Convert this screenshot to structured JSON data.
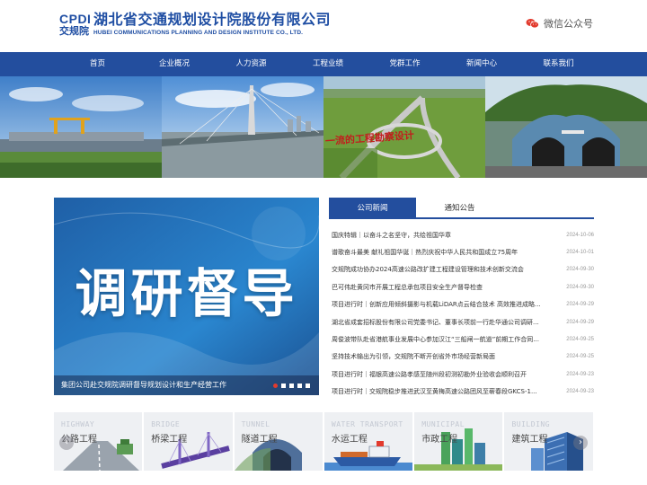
{
  "header": {
    "logo_en": "CPDI",
    "logo_cn": "交规院",
    "org_name_cn": "湖北省交通规划设计院股份有限公司",
    "org_name_en": "HUBEI COMMUNICATIONS PLANNING AND DESIGN INSTITUTE CO., LTD.",
    "wechat_label": "微信公众号"
  },
  "nav": {
    "items": [
      "首页",
      "企业概况",
      "人力资源",
      "工程业绩",
      "党群工作",
      "新闻中心",
      "联系我们"
    ]
  },
  "banner": {
    "slogan": "一流的工程勘察设计"
  },
  "feature": {
    "headline": "调研督导",
    "caption": "集团公司赴交规院调研督导规划设计和生产经营工作",
    "slide_count": 5,
    "active_slide": 1
  },
  "news": {
    "tabs": [
      "公司新闻",
      "通知公告"
    ],
    "active_tab": 0,
    "items": [
      {
        "title": "国庆特辑｜以奋斗之名坚守，共绘祖国华章",
        "date": "2024-10-06"
      },
      {
        "title": "谱歌奋斗最美 献礼祖国华诞｜热烈庆祝中华人民共和国成立75周年",
        "date": "2024-10-01"
      },
      {
        "title": "交规院成功协办2024高速公路改扩建工程建设管理和技术创新交流会",
        "date": "2024-09-30"
      },
      {
        "title": "巴可伟赴黄冈市开展工程总承包项目安全生产督导检查",
        "date": "2024-09-30"
      },
      {
        "title": "项目进行时｜创新应用倾斜摄影与机载LiDAR点云结合技术 高效推进成略...",
        "date": "2024-09-29"
      },
      {
        "title": "湖北省成套招标股份有限公司党委书记、董事长项前一行赴华通公司调研...",
        "date": "2024-09-29"
      },
      {
        "title": "周俊波带队赴省港航事业发展中心参加汉江“三船闸一航道”前期工作合同...",
        "date": "2024-09-25"
      },
      {
        "title": "坚持技术输出为引领，交规院不断开创省外市场经营新局面",
        "date": "2024-09-25"
      },
      {
        "title": "项目进行时｜福银高速公路孝感至随州段初测初勘外业验收会顺利召开",
        "date": "2024-09-23"
      },
      {
        "title": "项目进行时｜交规院稳步推进武汉至黄梅高速公路团风至蕲春段GKCS-1...",
        "date": "2024-09-23"
      }
    ]
  },
  "categories": [
    {
      "en": "HIGHWAY",
      "cn": "公路工程",
      "icon": "highway-icon"
    },
    {
      "en": "BRIDGE",
      "cn": "桥梁工程",
      "icon": "bridge-icon"
    },
    {
      "en": "TUNNEL",
      "cn": "隧道工程",
      "icon": "tunnel-icon"
    },
    {
      "en": "WATER TRANSPORT",
      "cn": "水运工程",
      "icon": "ship-icon"
    },
    {
      "en": "MUNICIPAL",
      "cn": "市政工程",
      "icon": "city-icon"
    },
    {
      "en": "BUILDING",
      "cn": "建筑工程",
      "icon": "building-icon"
    }
  ],
  "colors": {
    "brand_blue": "#234e9e",
    "accent_red": "#e23b2e"
  }
}
